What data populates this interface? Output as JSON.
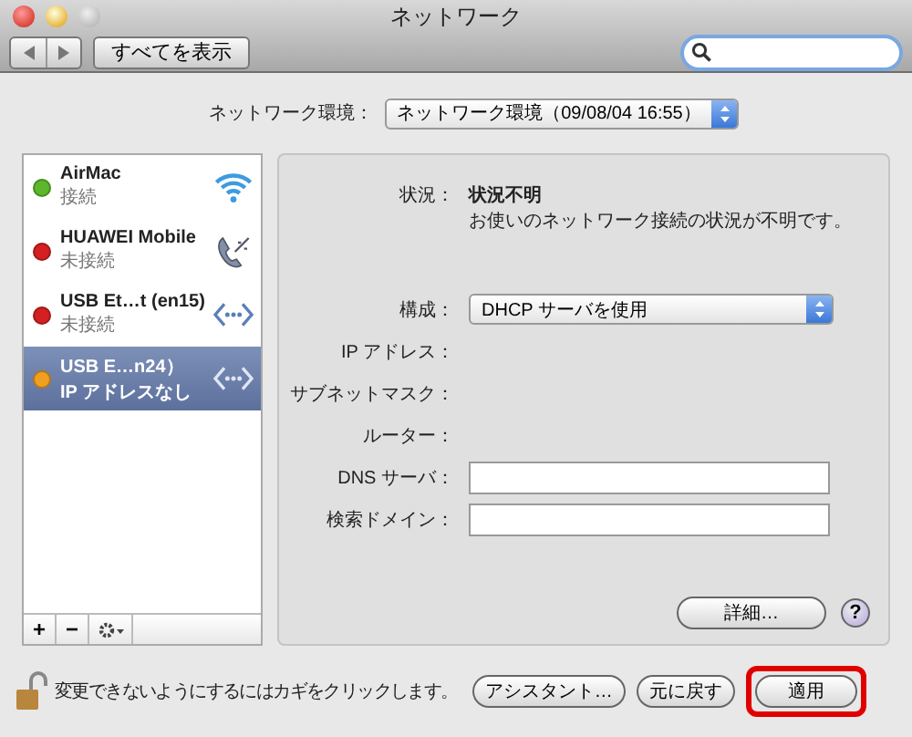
{
  "window": {
    "title": "ネットワーク"
  },
  "toolbar": {
    "show_all": "すべてを表示"
  },
  "location": {
    "label": "ネットワーク環境：",
    "value": "ネットワーク環境（09/08/04 16:55）"
  },
  "services": [
    {
      "name": "AirMac",
      "status": "接続",
      "color": "#5cb82a",
      "kind": "wifi",
      "selected": false
    },
    {
      "name": "HUAWEI Mobile",
      "status": "未接続",
      "color": "#d42020",
      "kind": "phone",
      "selected": false
    },
    {
      "name": "USB Et…t (en15)",
      "status": "未接続",
      "color": "#d42020",
      "kind": "ethernet",
      "selected": false
    },
    {
      "name": "USB E…n24）",
      "status": "IP アドレスなし",
      "color": "#f0a020",
      "kind": "ethernet",
      "selected": true
    }
  ],
  "list_buttons": [
    "+",
    "−"
  ],
  "detail": {
    "status_label": "状況：",
    "status_value": "状況不明",
    "status_note": "お使いのネットワーク接続の状況が不明です。",
    "config_label": "構成：",
    "config_value": "DHCP サーバを使用",
    "fields": [
      {
        "label": "IP アドレス：",
        "kind": "text"
      },
      {
        "label": "サブネットマスク：",
        "kind": "text"
      },
      {
        "label": "ルーター：",
        "kind": "text"
      },
      {
        "label": "DNS サーバ：",
        "kind": "input"
      },
      {
        "label": "検索ドメイン：",
        "kind": "input"
      }
    ],
    "advanced_button": "詳細…",
    "help_button": "?"
  },
  "footer": {
    "lock_text": "変更できないようにするにはカギをクリックします。",
    "buttons": [
      {
        "label": "アシスタント…",
        "highlighted": false
      },
      {
        "label": "元に戻す",
        "highlighted": false
      },
      {
        "label": "適用",
        "highlighted": true
      }
    ]
  }
}
